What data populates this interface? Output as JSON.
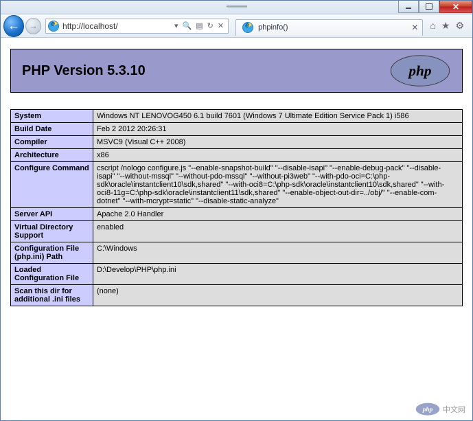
{
  "browser": {
    "address_url": "http://localhost/",
    "tab_title": "phpinfo()"
  },
  "page": {
    "header_title": "PHP Version 5.3.10",
    "logo_text": "php"
  },
  "info_rows": [
    {
      "label": "System",
      "value": "Windows NT LENOVOG450 6.1 build 7601 (Windows 7 Ultimate Edition Service Pack 1) i586"
    },
    {
      "label": "Build Date",
      "value": "Feb 2 2012 20:26:31"
    },
    {
      "label": "Compiler",
      "value": "MSVC9 (Visual C++ 2008)"
    },
    {
      "label": "Architecture",
      "value": "x86"
    },
    {
      "label": "Configure Command",
      "value": "cscript /nologo configure.js \"--enable-snapshot-build\" \"--disable-isapi\" \"--enable-debug-pack\" \"--disable-isapi\" \"--without-mssql\" \"--without-pdo-mssql\" \"--without-pi3web\" \"--with-pdo-oci=C:\\php-sdk\\oracle\\instantclient10\\sdk,shared\" \"--with-oci8=C:\\php-sdk\\oracle\\instantclient10\\sdk,shared\" \"--with-oci8-11g=C:\\php-sdk\\oracle\\instantclient11\\sdk,shared\" \"--enable-object-out-dir=../obj/\" \"--enable-com-dotnet\" \"--with-mcrypt=static\" \"--disable-static-analyze\""
    },
    {
      "label": "Server API",
      "value": "Apache 2.0 Handler"
    },
    {
      "label": "Virtual Directory Support",
      "value": "enabled"
    },
    {
      "label": "Configuration File (php.ini) Path",
      "value": "C:\\Windows"
    },
    {
      "label": "Loaded Configuration File",
      "value": "D:\\Develop\\PHP\\php.ini"
    },
    {
      "label": "Scan this dir for additional .ini files",
      "value": "(none)"
    }
  ],
  "watermark": {
    "logo_text": "php",
    "site_text": "中文网"
  }
}
